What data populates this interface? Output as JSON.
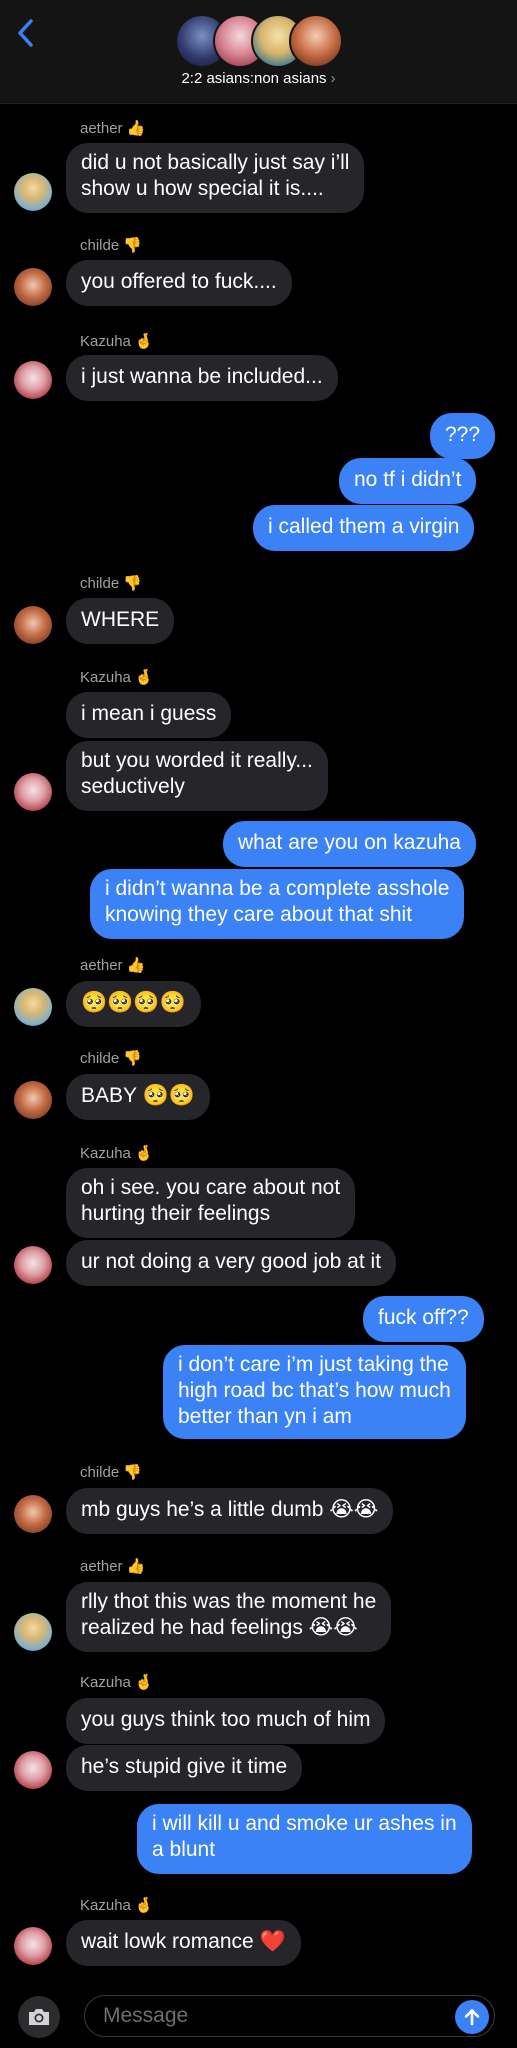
{
  "header": {
    "back_icon": "chevron-left-icon",
    "group_name": "2:2 asians:non asians",
    "chevron": "›"
  },
  "senders": {
    "aether": {
      "name": "aether",
      "emoji": "👍"
    },
    "childe": {
      "name": "childe",
      "emoji": "👎"
    },
    "kazuha": {
      "name": "Kazuha",
      "emoji": "🤞"
    }
  },
  "messages": [
    {
      "from": "aether",
      "text": "did u not basically just say i’ll"
    },
    {
      "from": "aether",
      "text": "show u how special it is...."
    },
    {
      "from": "childe",
      "text": "you offered to fuck...."
    },
    {
      "from": "kazuha",
      "text": "i just wanna be included..."
    },
    {
      "from": "me",
      "text": "???"
    },
    {
      "from": "me",
      "text": "no tf i didn’t"
    },
    {
      "from": "me",
      "text": "i called them a virgin"
    },
    {
      "from": "childe",
      "text": "WHERE"
    },
    {
      "from": "kazuha",
      "text": "i mean i guess"
    },
    {
      "from": "kazuha",
      "text": "but you worded it really..."
    },
    {
      "from": "kazuha",
      "text": "seductively"
    },
    {
      "from": "me",
      "text": "what are you on kazuha"
    },
    {
      "from": "me",
      "text": "i didn’t wanna be a complete asshole"
    },
    {
      "from": "me",
      "text": "knowing they care about that shit"
    },
    {
      "from": "aether",
      "text": "🥺🥺🥺🥺"
    },
    {
      "from": "childe",
      "text": "BABY 🥺🥺"
    },
    {
      "from": "kazuha",
      "text": "oh i see. you care about not"
    },
    {
      "from": "kazuha",
      "text": "hurting their feelings"
    },
    {
      "from": "kazuha",
      "text": "ur not doing a very good job at it"
    },
    {
      "from": "me",
      "text": "fuck off??"
    },
    {
      "from": "me",
      "text": "i don’t care i’m just taking the"
    },
    {
      "from": "me",
      "text": "high road bc that’s how much"
    },
    {
      "from": "me",
      "text": "better than yn i am"
    },
    {
      "from": "childe",
      "text": "mb guys he’s a little dumb 😭😭"
    },
    {
      "from": "aether",
      "text": "rlly thot this was the moment he"
    },
    {
      "from": "aether",
      "text": "realized he had feelings 😭😭"
    },
    {
      "from": "kazuha",
      "text": "you guys think too much of him"
    },
    {
      "from": "kazuha",
      "text": "he’s stupid give it time"
    },
    {
      "from": "me",
      "text": "i will kill u and smoke ur ashes in"
    },
    {
      "from": "me",
      "text": "a blunt"
    },
    {
      "from": "kazuha",
      "text": "wait lowk romance ❤️"
    }
  ],
  "composer": {
    "placeholder": "Message",
    "camera_icon": "camera-icon",
    "send_icon": "arrow-up-icon"
  },
  "colors": {
    "incoming_bubble": "#26262a",
    "outgoing_bubble": "#3a82f6",
    "background": "#000000",
    "accent": "#3a82f6"
  }
}
